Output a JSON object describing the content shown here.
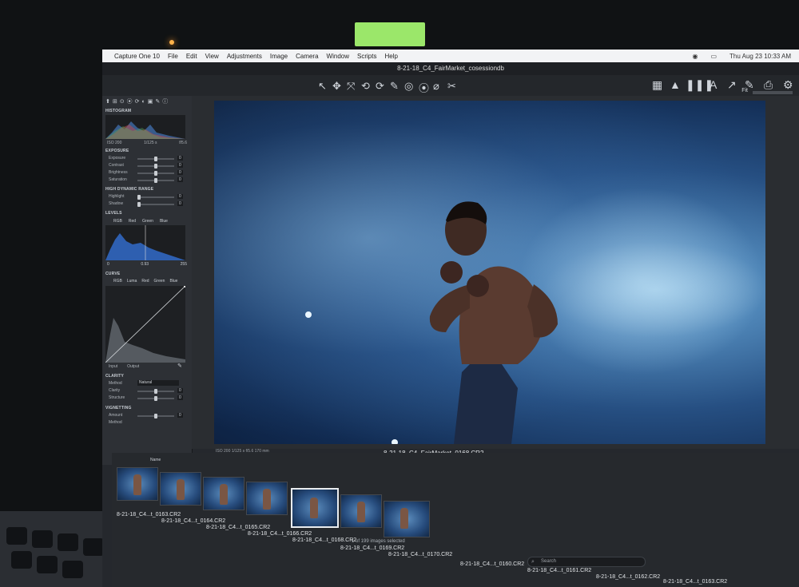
{
  "app": {
    "menubar": {
      "apple": "",
      "items": [
        "Capture One 10",
        "File",
        "Edit",
        "View",
        "Adjustments",
        "Image",
        "Camera",
        "Window",
        "Scripts",
        "Help"
      ],
      "clock": "Thu Aug 23 10:33 AM"
    },
    "window_title": "8-21-18_C4_FairMarket_cosessiondb",
    "zoom_label": "Fit"
  },
  "toolbar": {
    "cursor_tools": [
      "↖",
      "✥",
      "⤧",
      "⟲",
      "⟳",
      "✎",
      "◎",
      "⦿",
      "⌀",
      "✂"
    ],
    "right_tools": [
      "▦",
      "▲",
      "❚❚❚",
      "A",
      "↗",
      "✎",
      "⎙",
      "⚙"
    ]
  },
  "left_panel": {
    "tabs": [
      "⬆",
      "⊞",
      "⊙",
      "⦿",
      "⟳",
      "◐",
      "▣",
      "✎",
      "ⓘ"
    ],
    "sections": {
      "histogram": "HISTOGRAM",
      "histogram_meta": {
        "iso": "ISO 200",
        "shutter": "1/125 s",
        "aperture": "f/5.6"
      },
      "exposure": "EXPOSURE",
      "exposure_rows": [
        {
          "label": "Exposure",
          "value": "0"
        },
        {
          "label": "Contrast",
          "value": "0"
        },
        {
          "label": "Brightness",
          "value": "0"
        },
        {
          "label": "Saturation",
          "value": "0"
        }
      ],
      "hdr": "HIGH DYNAMIC RANGE",
      "hdr_rows": [
        {
          "label": "Highlight",
          "value": "0"
        },
        {
          "label": "Shadow",
          "value": "0"
        }
      ],
      "levels": "LEVELS",
      "levels_channels": [
        "RGB",
        "Red",
        "Green",
        "Blue"
      ],
      "levels_vals": {
        "black": "0",
        "mid": "0.93",
        "white": "255"
      },
      "curve": "CURVE",
      "curve_channels": [
        "RGB",
        "Luma",
        "Red",
        "Green",
        "Blue"
      ],
      "curve_io": {
        "input": "Input",
        "output": "Output"
      },
      "clarity": "CLARITY",
      "clarity_rows": [
        {
          "label": "Method",
          "value": "Natural"
        },
        {
          "label": "Clarity",
          "value": "0"
        },
        {
          "label": "Structure",
          "value": "0"
        }
      ],
      "vignetting": "VIGNETTING",
      "vignetting_rows": [
        {
          "label": "Amount",
          "value": "0"
        },
        {
          "label": "Method",
          "value": "Elliptic on Crop"
        }
      ]
    }
  },
  "viewer": {
    "status": "ISO 200   1/125 s   f/5.6   170 mm",
    "caption": "8-21-18_C4_FairMarket_0168.CR2"
  },
  "browser": {
    "collection": "Name",
    "selection": "1 of 199 images selected",
    "search_placeholder": "Search",
    "thumbnails": [
      {
        "name": "8-21-18_C4...t_0163.CR2",
        "selected": false
      },
      {
        "name": "8-21-18_C4...t_0164.CR2",
        "selected": false
      },
      {
        "name": "8-21-18_C4...t_0165.CR2",
        "selected": false
      },
      {
        "name": "8-21-18_C4...t_0166.CR2",
        "selected": false
      },
      {
        "name": "8-21-18_C4...t_0167.CR2",
        "selected": false
      },
      {
        "name": "8-21-18_C4...t_0168.CR2",
        "selected": true
      },
      {
        "name": "8-21-18_C4...t_0169.CR2",
        "selected": false
      },
      {
        "name": "8-21-18_C4...t_0170.CR2",
        "selected": false
      }
    ],
    "right_names": [
      "8-21-18_C4...t_0160.CR2",
      "8-21-18_C4...t_0161.CR2",
      "8-21-18_C4...t_0162.CR2",
      "8-21-18_C4...t_0163.CR2"
    ]
  }
}
